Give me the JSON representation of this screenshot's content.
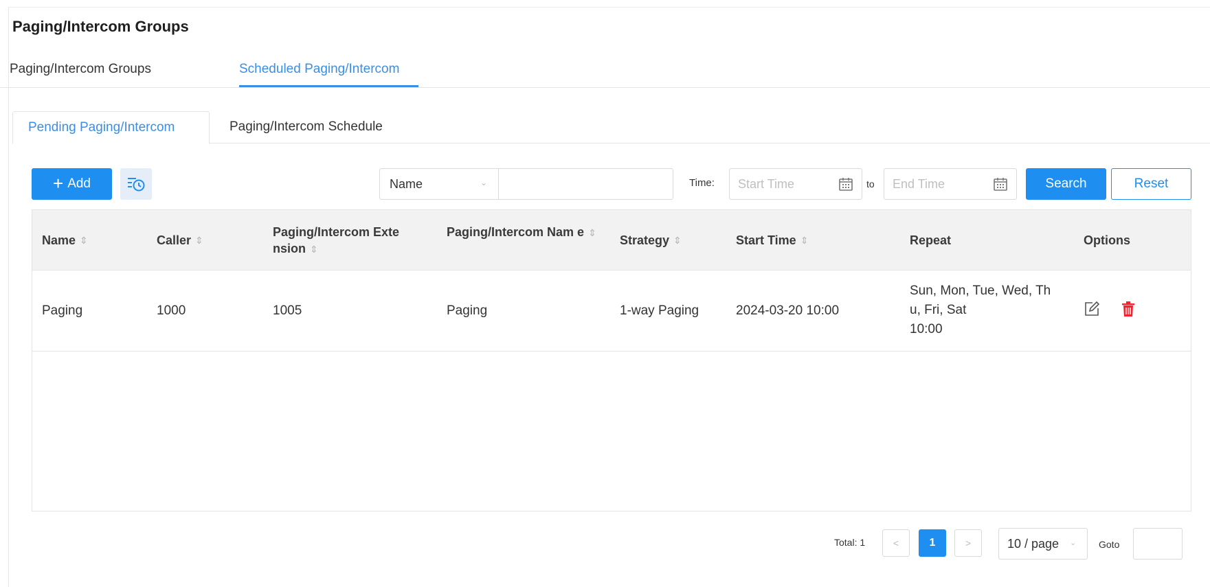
{
  "page": {
    "title": "Paging/Intercom Groups"
  },
  "top_tabs": [
    {
      "label": "Paging/Intercom Groups",
      "active": false
    },
    {
      "label": "Scheduled Paging/Intercom",
      "active": true
    }
  ],
  "sub_tabs": [
    {
      "label": "Pending Paging/Intercom",
      "active": true
    },
    {
      "label": "Paging/Intercom Schedule",
      "active": false
    }
  ],
  "toolbar": {
    "add_label": "Add",
    "add_icon": "plus-icon",
    "schedule_icon": "schedule-list-icon",
    "filter_select": "Name",
    "filter_value": "",
    "time_label": "Time:",
    "start_placeholder": "Start Time",
    "to_label": "to",
    "end_placeholder": "End Time",
    "search_label": "Search",
    "reset_label": "Reset"
  },
  "table": {
    "columns": [
      {
        "label": "Name",
        "sortable": true
      },
      {
        "label": "Caller",
        "sortable": true
      },
      {
        "label": "Paging/Intercom Exte nsion",
        "sortable": true
      },
      {
        "label": "Paging/Intercom Nam e",
        "sortable": true
      },
      {
        "label": "Strategy",
        "sortable": true
      },
      {
        "label": "Start Time",
        "sortable": true
      },
      {
        "label": "Repeat",
        "sortable": false
      },
      {
        "label": "Options",
        "sortable": false
      }
    ],
    "rows": [
      {
        "name": "Paging",
        "caller": "1000",
        "extension": "1005",
        "group_name": "Paging",
        "strategy": "1-way Paging",
        "start_time": "2024-03-20 10:00",
        "repeat": "Sun, Mon, Tue, Wed, Th\nu, Fri, Sat\n10:00"
      }
    ]
  },
  "pagination": {
    "total": "Total: 1",
    "prev": "<",
    "current_page": "1",
    "next": ">",
    "page_size": "10 / page",
    "goto_label": "Goto",
    "goto_value": ""
  },
  "colors": {
    "accent": "#1e8ef0",
    "link": "#3a8ee6",
    "danger": "#f5222d",
    "header_bg": "#f2f2f2"
  }
}
